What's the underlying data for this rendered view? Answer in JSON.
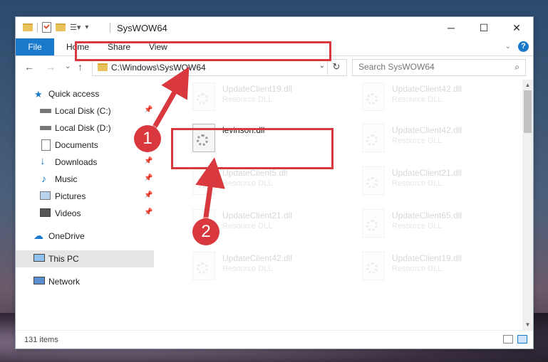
{
  "window": {
    "title": "SysWOW64"
  },
  "ribbon": {
    "tabs": [
      "File",
      "Home",
      "Share",
      "View"
    ]
  },
  "titlebar": {
    "minimize": "─",
    "maximize": "☐",
    "close": "✕"
  },
  "address": {
    "path": "C:\\Windows\\SysWOW64"
  },
  "search": {
    "placeholder": "Search SysWOW64"
  },
  "sidebar": {
    "quick_access": "Quick access",
    "items": [
      {
        "label": "Local Disk (C:)",
        "icon": "drive-icon",
        "pinned": true
      },
      {
        "label": "Local Disk (D:)",
        "icon": "drive-icon",
        "pinned": false
      },
      {
        "label": "Documents",
        "icon": "documents-icon",
        "pinned": true
      },
      {
        "label": "Downloads",
        "icon": "downloads-icon",
        "pinned": true
      },
      {
        "label": "Music",
        "icon": "music-icon",
        "pinned": true
      },
      {
        "label": "Pictures",
        "icon": "pictures-icon",
        "pinned": true
      },
      {
        "label": "Videos",
        "icon": "videos-icon",
        "pinned": true
      }
    ],
    "onedrive": "OneDrive",
    "this_pc": "This PC",
    "network": "Network"
  },
  "files": {
    "highlighted": {
      "name": "levinson.dll"
    },
    "faded": [
      {
        "name": "UpdateClient19.dll",
        "type": "Resource DLL"
      },
      {
        "name": "UpdateClient42.dll",
        "type": "Resource DLL"
      },
      {
        "name": "UpdateClient42.dll",
        "type": "Resource DLL"
      },
      {
        "name": "UpdateClient5.dll",
        "type": "Resource DLL"
      },
      {
        "name": "UpdateClient21.dll",
        "type": "Resource DLL"
      },
      {
        "name": "UpdateClient21.dll",
        "type": "Resource DLL"
      },
      {
        "name": "UpdateClient65.dll",
        "type": "Resource DLL"
      },
      {
        "name": "UpdateClient42.dll",
        "type": "Resource DLL"
      },
      {
        "name": "UpdateClient19.dll",
        "type": "Resource DLL"
      }
    ]
  },
  "status": {
    "count": "131 items"
  },
  "annotations": {
    "step1": "1",
    "step2": "2",
    "color": "#d9383e"
  }
}
